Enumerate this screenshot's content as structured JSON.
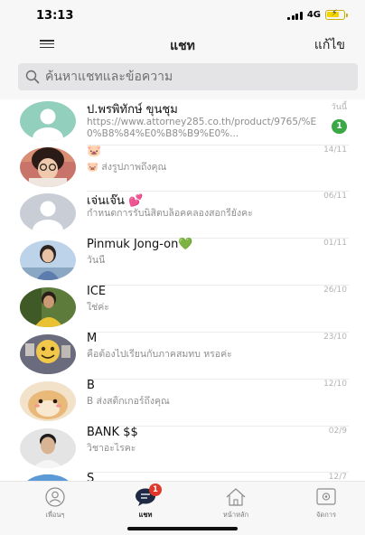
{
  "status_bar": {
    "time": "13:13",
    "network": "4G"
  },
  "header": {
    "title": "แชท",
    "edit_label": "แก้ไข",
    "menu_icon": "hamburger-menu-icon"
  },
  "search": {
    "placeholder": "ค้นหาแชทและข้อความ",
    "icon": "search-icon"
  },
  "chats": [
    {
      "name": "ป.พรพิทักษ์ ขุนชุม",
      "preview": "https://www.attorney285.co.th/product/9765/%E0%B8%84%E0%B8%B9%E0%...",
      "time": "วันนี้",
      "unread": "1",
      "avatar": "default-avatar-green"
    },
    {
      "name": "🐷",
      "preview": "🐷 ส่งรูปภาพถึงคุณ",
      "time": "14/11",
      "avatar": "photo-avatar-girl-glasses"
    },
    {
      "name": "เจ่นเจ๊น 💕",
      "preview": "กำหนดการรับนิสิตบล็อคคลองสอกรียังคะ",
      "time": "06/11",
      "avatar": "default-avatar-grey"
    },
    {
      "name": "Pinmuk Jong-on💚",
      "preview": "วันนี้",
      "time": "01/11",
      "avatar": "photo-avatar-girl-sky"
    },
    {
      "name": "ICE",
      "preview": "ใช่ค่ะ",
      "time": "26/10",
      "avatar": "photo-avatar-man-yellow"
    },
    {
      "name": "M",
      "preview": "คือต้องไปเรียนกับภาคสมทบ หรอค่ะ",
      "time": "23/10",
      "avatar": "photo-avatar-emoji-face"
    },
    {
      "name": "B",
      "preview": "B ส่งสติ๊กเกอร์ถึงคุณ",
      "time": "12/10",
      "avatar": "photo-avatar-hamster"
    },
    {
      "name": "BANK $$",
      "preview": "วิชาอะไรคะ",
      "time": "02/9",
      "avatar": "photo-avatar-man-white"
    },
    {
      "name": "S",
      "preview": "",
      "time": "12/7",
      "avatar": "photo-avatar-blue"
    }
  ],
  "tabs": [
    {
      "label": "เพื่อนๆ",
      "icon": "friends-icon"
    },
    {
      "label": "แชท",
      "icon": "chat-bubble-icon",
      "badge": "1"
    },
    {
      "label": "หน้าหลัก",
      "icon": "home-icon"
    },
    {
      "label": "จัดการ",
      "icon": "manage-icon"
    }
  ],
  "colors": {
    "unread_badge": "#3aa845",
    "tab_badge": "#e2382b",
    "battery": "#f2d400",
    "default_avatar_green": "#92cfbd"
  }
}
